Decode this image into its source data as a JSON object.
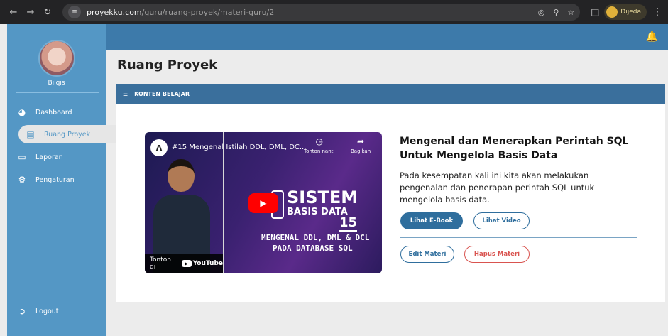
{
  "browser": {
    "url_domain": "proyekku.com",
    "url_path": "/guru/ruang-proyek/materi-guru/2",
    "profile_name": "Dijeda"
  },
  "sidebar": {
    "user_name": "Bilqis",
    "items": [
      {
        "label": "Dashboard",
        "icon": "dashboard-icon"
      },
      {
        "label": "Ruang Proyek",
        "icon": "document-icon",
        "active": true
      },
      {
        "label": "Laporan",
        "icon": "chart-icon"
      },
      {
        "label": "Pengaturan",
        "icon": "gear-icon"
      }
    ],
    "logout_label": "Logout"
  },
  "page": {
    "title": "Ruang Proyek",
    "section_label": "KONTEN BELAJAR"
  },
  "video": {
    "title": "#15 Mengenal Istilah DDL, DML, DC...",
    "watch_later": "Tonton nanti",
    "share": "Bagikan",
    "headline": "SISTEM",
    "subheadline": "BASIS DATA",
    "episode": "15",
    "line1": "MENGENAL DDL, DML & DCL",
    "line2": "PADA DATABASE SQL",
    "watch_on": "Tonton di",
    "youtube": "YouTube"
  },
  "materi": {
    "title": "Mengenal dan Menerapkan Perintah SQL Untuk Mengelola Basis Data",
    "description": "Pada kesempatan kali ini kita akan melakukan pengenalan dan penerapan perintah SQL untuk mengelola basis data.",
    "ebook_label": "Lihat E-Book",
    "video_label": "Lihat Video",
    "edit_label": "Edit Materi",
    "delete_label": "Hapus Materi"
  },
  "colors": {
    "sidebar": "#5497c5",
    "header": "#3d7aaa",
    "primary": "#2f6e9d",
    "danger": "#d9534f"
  }
}
